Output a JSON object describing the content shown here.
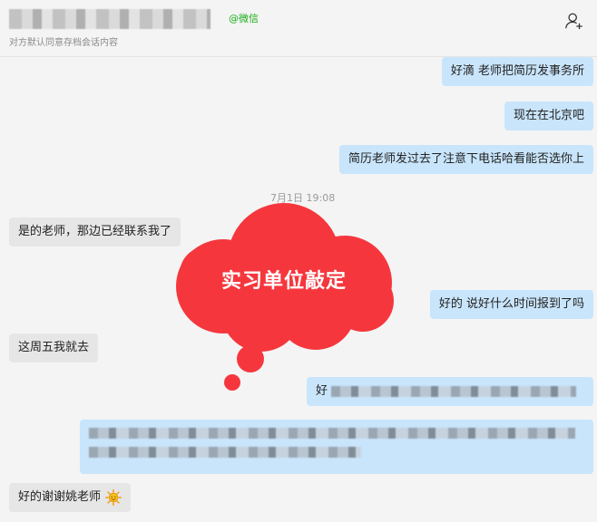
{
  "header": {
    "wechat_tag": "@微信",
    "subtitle": "对方默认同意存档会话内容"
  },
  "messages": {
    "m1": "好滴 老师把简历发事务所",
    "m2": "现在在北京吧",
    "m3": "简历老师发过去了注意下电话哈看能否选你上",
    "ts1": "7月1日 19:08",
    "m4": "是的老师，那边已经联系我了",
    "m5": "好的 说好什么时间报到了吗",
    "m6": "这周五我就去",
    "m7_prefix": "好",
    "m8": "好的谢谢姚老师"
  },
  "overlay": {
    "label": "实习单位敲定",
    "color": "#f5373d"
  },
  "icons": {
    "add_user": "add-user-icon",
    "emoji": "sun-smile-emoji-icon"
  }
}
